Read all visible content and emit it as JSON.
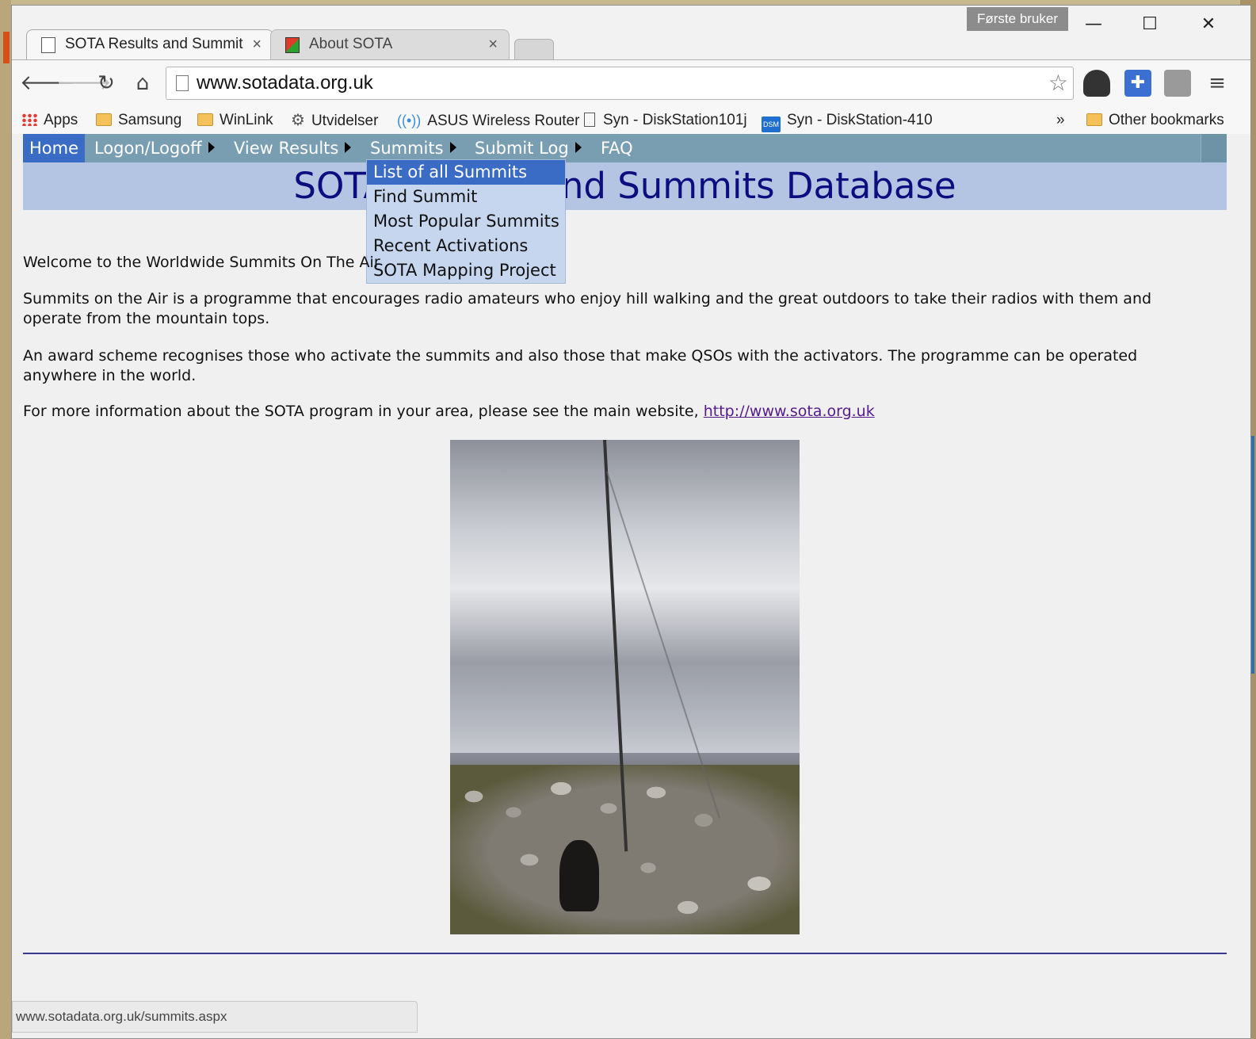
{
  "browser": {
    "profile_label": "Første bruker",
    "tabs": [
      {
        "title": "SOTA Results and Summit",
        "close": "×"
      },
      {
        "title": "About SOTA",
        "close": "×"
      }
    ],
    "window_controls": {
      "minimize": "—",
      "maximize": "☐",
      "close": "✕"
    },
    "address": "www.sotadata.org.uk",
    "bookmarks": [
      {
        "label": "Apps",
        "icon": "apps-grid-icon"
      },
      {
        "label": "Samsung",
        "icon": "folder-icon"
      },
      {
        "label": "WinLink",
        "icon": "folder-icon"
      },
      {
        "label": "Utvidelser",
        "icon": "gear-icon"
      },
      {
        "label": "ASUS Wireless Router",
        "icon": "wireless-icon"
      },
      {
        "label": "Syn - DiskStation101j",
        "icon": "page-icon"
      },
      {
        "label": "Syn - DiskStation-410",
        "icon": "dsm-icon"
      }
    ],
    "bookmarks_overflow": "»",
    "other_bookmarks": "Other bookmarks",
    "status_url": "www.sotadata.org.uk/summits.aspx"
  },
  "nav": {
    "items": [
      "Home",
      "Logon/Logoff",
      "View Results",
      "Summits",
      "Submit Log",
      "FAQ"
    ],
    "summits_menu": [
      "List of all Summits",
      "Find Summit",
      "Most Popular Summits",
      "Recent Activations",
      "SOTA Mapping Project"
    ]
  },
  "page": {
    "banner_title": "SOTA Results and Summits Database",
    "welcome": "Welcome to the Worldwide Summits On The Air",
    "para1": "Summits on the Air is a programme that encourages radio amateurs who enjoy hill walking and the great outdoors to take their radios with them and operate from the mountain tops.",
    "para2": "An award scheme recognises those who activate the summits and also those that make QSOs with the activators. The programme can be operated anywhere in the world.",
    "para3_prefix": "For more information about the SOTA program in your area, please see the main website, ",
    "para3_link": "http://www.sota.org.uk"
  },
  "colors": {
    "nav_bg": "#7a9eb1",
    "nav_active": "#3a6cc6",
    "banner_bg": "#b3c5e3",
    "banner_text": "#0d0d80",
    "menu_bg": "#c7d6ef"
  }
}
